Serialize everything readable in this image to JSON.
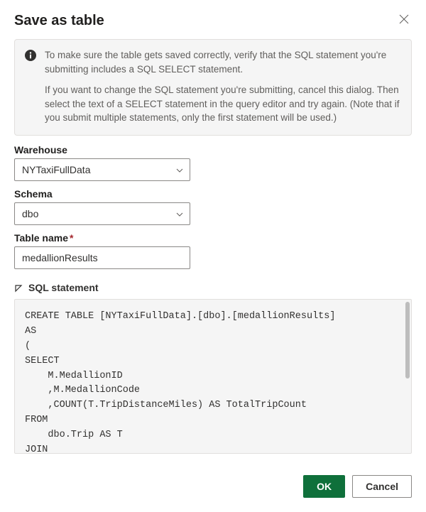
{
  "dialog": {
    "title": "Save as table",
    "info": {
      "p1": "To make sure the table gets saved correctly, verify that the SQL statement you're submitting includes a SQL SELECT statement.",
      "p2": "If you want to change the SQL statement you're submitting, cancel this dialog. Then select the text of a SELECT statement in the query editor and try again. (Note that if you submit multiple statements, only the first statement will be used.)"
    },
    "fields": {
      "warehouse": {
        "label": "Warehouse",
        "value": "NYTaxiFullData"
      },
      "schema": {
        "label": "Schema",
        "value": "dbo"
      },
      "tableName": {
        "label": "Table name",
        "value": "medallionResults"
      }
    },
    "sqlSection": {
      "label": "SQL statement",
      "code": "CREATE TABLE [NYTaxiFullData].[dbo].[medallionResults]\nAS\n(\nSELECT\n    M.MedallionID\n    ,M.MedallionCode\n    ,COUNT(T.TripDistanceMiles) AS TotalTripCount\nFROM\n    dbo.Trip AS T\nJOIN"
    },
    "buttons": {
      "ok": "OK",
      "cancel": "Cancel"
    }
  }
}
